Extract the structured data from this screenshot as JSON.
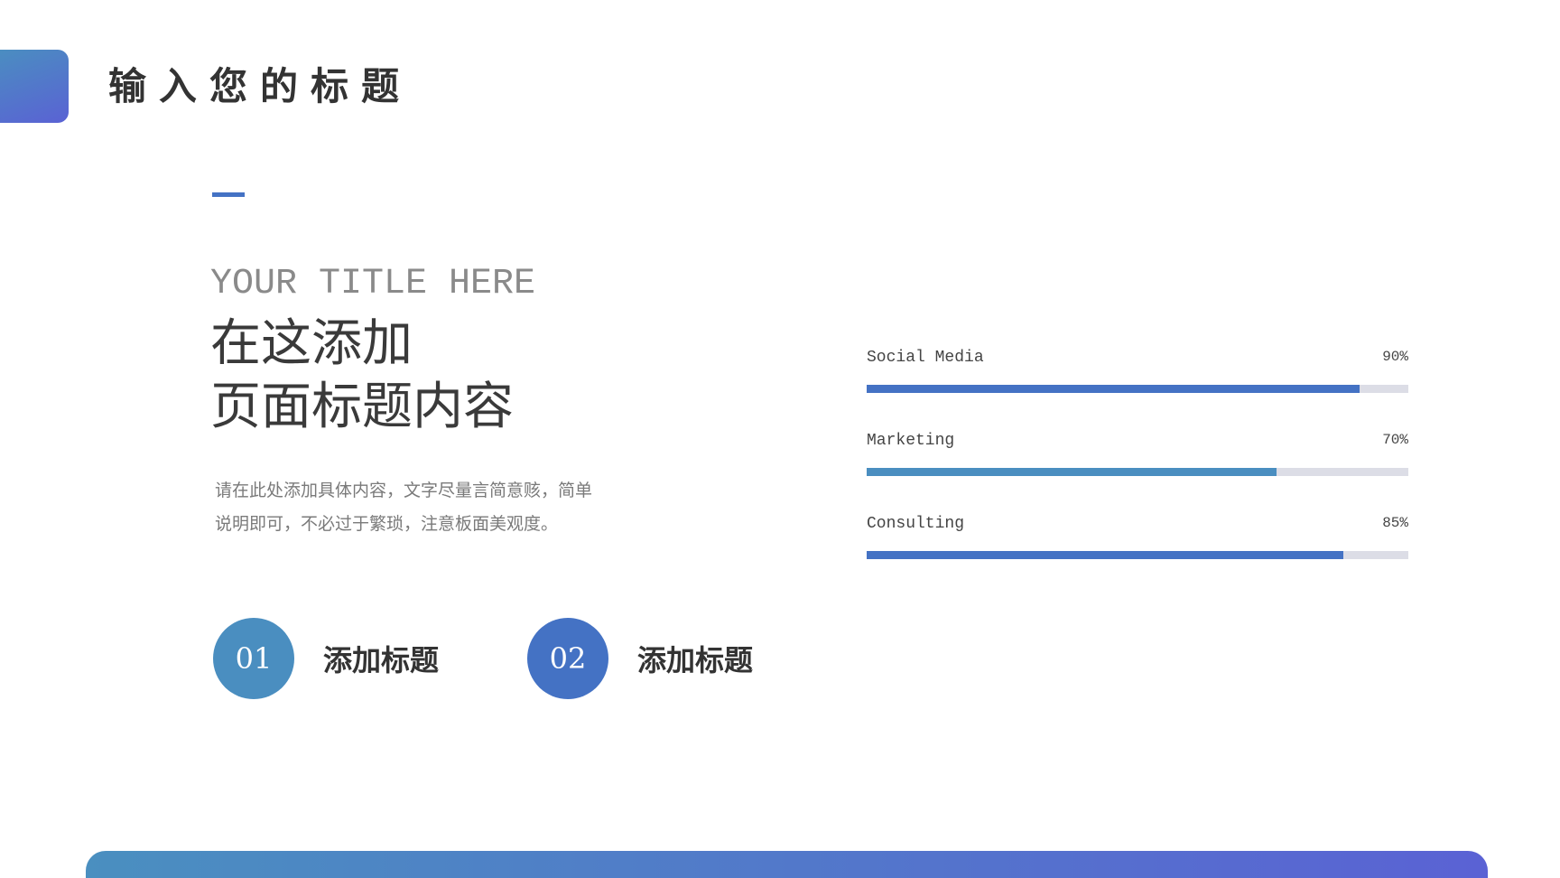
{
  "header": {
    "title": "输入您的标题"
  },
  "intro": {
    "english_title": "YOUR TITLE HERE",
    "chinese_title_line1": "在这添加",
    "chinese_title_line2": "页面标题内容",
    "body_line1": "请在此处添加具体内容，文字尽量言简意赅，简单",
    "body_line2": "说明即可，不必过于繁琐，注意板面美观度。"
  },
  "items": [
    {
      "number": "01",
      "label": "添加标题",
      "color": "#4a8ec0"
    },
    {
      "number": "02",
      "label": "添加标题",
      "color": "#4472c4"
    }
  ],
  "progress": [
    {
      "name": "Social Media",
      "percent_label": "90%",
      "fraction": 0.91,
      "color": "#4472c4"
    },
    {
      "name": "Marketing",
      "percent_label": "70%",
      "fraction": 0.757,
      "color": "#4a8ec0"
    },
    {
      "name": "Consulting",
      "percent_label": "85%",
      "fraction": 0.88,
      "color": "#4472c4"
    }
  ],
  "colors": {
    "accent_blue": "#4472c4",
    "accent_teal": "#4a8ec0",
    "gradient_end": "#5a62d4",
    "track": "#dcdde6"
  }
}
